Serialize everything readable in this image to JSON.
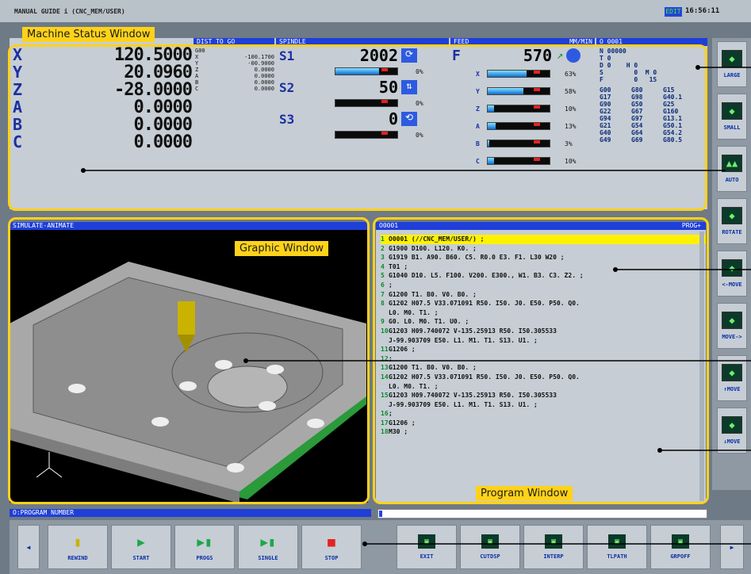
{
  "top": {
    "title": "MANUAL GUIDE i (CNC_MEM/USER)",
    "mode": "EDIT",
    "clock": "16:56:11"
  },
  "status": {
    "header_dist": "DIST TO GO",
    "header_spindle": "SPINDLE",
    "header_feed": "FEED",
    "header_feed_unit": "MM/MIN",
    "header_prog": "O 0001",
    "axes": [
      {
        "label": "X",
        "value": "120.5000"
      },
      {
        "label": "Y",
        "value": "20.0960"
      },
      {
        "label": "Z",
        "value": "-28.0000"
      },
      {
        "label": "A",
        "value": "0.0000"
      },
      {
        "label": "B",
        "value": "0.0000"
      },
      {
        "label": "C",
        "value": "0.0000"
      }
    ],
    "dist_head": "G00",
    "dist": [
      {
        "label": "X",
        "value": "-100.1700"
      },
      {
        "label": "Y",
        "value": "-00.9000"
      },
      {
        "label": "Z",
        "value": "0.0000"
      },
      {
        "label": "A",
        "value": "0.0000"
      },
      {
        "label": "B",
        "value": "0.0000"
      },
      {
        "label": "C",
        "value": "0.0000"
      }
    ],
    "spindles": [
      {
        "label": "S1",
        "value": "2002",
        "load": "0%",
        "fill": 0.7
      },
      {
        "label": "S2",
        "value": "50",
        "load": "0%",
        "fill": 0.0
      },
      {
        "label": "S3",
        "value": "0",
        "load": "0%",
        "fill": 0.0
      }
    ],
    "feed_label": "F",
    "feed_value": "570",
    "feed_loads": [
      {
        "axis": "X",
        "pct": "63%",
        "fill": 0.63
      },
      {
        "axis": "Y",
        "pct": "58%",
        "fill": 0.58
      },
      {
        "axis": "Z",
        "pct": "10%",
        "fill": 0.1
      },
      {
        "axis": "A",
        "pct": "13%",
        "fill": 0.13
      },
      {
        "axis": "B",
        "pct": "3%",
        "fill": 0.03
      },
      {
        "axis": "C",
        "pct": "10%",
        "fill": 0.1
      }
    ],
    "modal_top": [
      "N 00000",
      "T 0",
      "D 0    H 0",
      "S        0  M 0",
      "F        0   15"
    ],
    "modal_codes": [
      [
        "G00",
        "G80",
        "G15"
      ],
      [
        "G17",
        "G98",
        "G40.1"
      ],
      [
        "G90",
        "G50",
        "G25"
      ],
      [
        "G22",
        "G67",
        "G160"
      ],
      [
        "G94",
        "G97",
        "G13.1"
      ],
      [
        "G21",
        "G54",
        "G50.1"
      ],
      [
        "G40",
        "G64",
        "G54.2"
      ],
      [
        "G49",
        "G69",
        "G80.5"
      ]
    ]
  },
  "graphic": {
    "title": "SIMULATE-ANIMATE"
  },
  "program": {
    "title": "O0001",
    "title_right": "PROG+",
    "lines": [
      {
        "n": "1",
        "text": "O0001 (//CNC_MEM/USER/) ;",
        "hl": true
      },
      {
        "n": "2",
        "text": "G1900 D100. L120. K0. ;"
      },
      {
        "n": "3",
        "text": "G1919 B1. A90. B60. C5. R0.0 E3. F1. L30 W20 ;"
      },
      {
        "n": "4",
        "text": "T01 ;"
      },
      {
        "n": "5",
        "text": "G1040 D10. L5. F100. V200. E300., W1. B3. C3. Z2. ;"
      },
      {
        "n": "6",
        "text": ";"
      },
      {
        "n": "7",
        "text": "G1200 T1. B0. V0. B0. ;"
      },
      {
        "n": "8",
        "text": "G1202 H07.5 V33.071091 R50. I50. J0. E50. P50. Q0."
      },
      {
        "n": "",
        "text": "L0. M0. T1. ;"
      },
      {
        "n": "9",
        "text": "G0. L0. M0. T1. U0. ;"
      },
      {
        "n": "10",
        "text": "G1203 H09.740072 V-135.25913 R50. I50.305533"
      },
      {
        "n": "",
        "text": "J-99.903709 E50. L1. M1. T1. S13. U1. ;"
      },
      {
        "n": "11",
        "text": "G1206 ;"
      },
      {
        "n": "12",
        "text": ";"
      },
      {
        "n": "13",
        "text": "G1200 T1. B0. V0. B0. ;"
      },
      {
        "n": "14",
        "text": "G1202 H07.5 V33.071091 R50. I50. J0. E50. P50. Q0."
      },
      {
        "n": "",
        "text": "L0. M0. T1. ;"
      },
      {
        "n": "15",
        "text": "G1203 H09.740072 V-135.25913 R50. I50.305533"
      },
      {
        "n": "",
        "text": "J-99.903709 E50. L1. M1. T1. S13. U1. ;"
      },
      {
        "n": "16",
        "text": ";"
      },
      {
        "n": "17",
        "text": "G1206 ;"
      },
      {
        "n": "18",
        "text": "M30 ;"
      }
    ]
  },
  "bottom": {
    "status_label": "O:PROGRAM NUMBER",
    "left_btns": [
      {
        "name": "rewind",
        "label": "REWIND"
      },
      {
        "name": "start",
        "label": "START"
      },
      {
        "name": "progs",
        "label": "PROGS"
      },
      {
        "name": "single",
        "label": "SINGLE"
      },
      {
        "name": "stop",
        "label": "STOP"
      }
    ],
    "right_btns": [
      {
        "name": "exit",
        "label": "EXIT"
      },
      {
        "name": "cutdsp",
        "label": "CUTDSP"
      },
      {
        "name": "interp",
        "label": "INTERP"
      },
      {
        "name": "tlpath",
        "label": "TLPATH"
      },
      {
        "name": "grpoff",
        "label": "GRPOFF"
      }
    ]
  },
  "side": {
    "buttons": [
      "LARGE",
      "SMALL",
      "AUTO",
      "ROTATE",
      "<-MOVE",
      "MOVE->",
      "↑MOVE",
      "↓MOVE"
    ]
  },
  "callouts": {
    "status": "Machine Status Window",
    "graphic": "Graphic Window",
    "program": "Program Window"
  }
}
